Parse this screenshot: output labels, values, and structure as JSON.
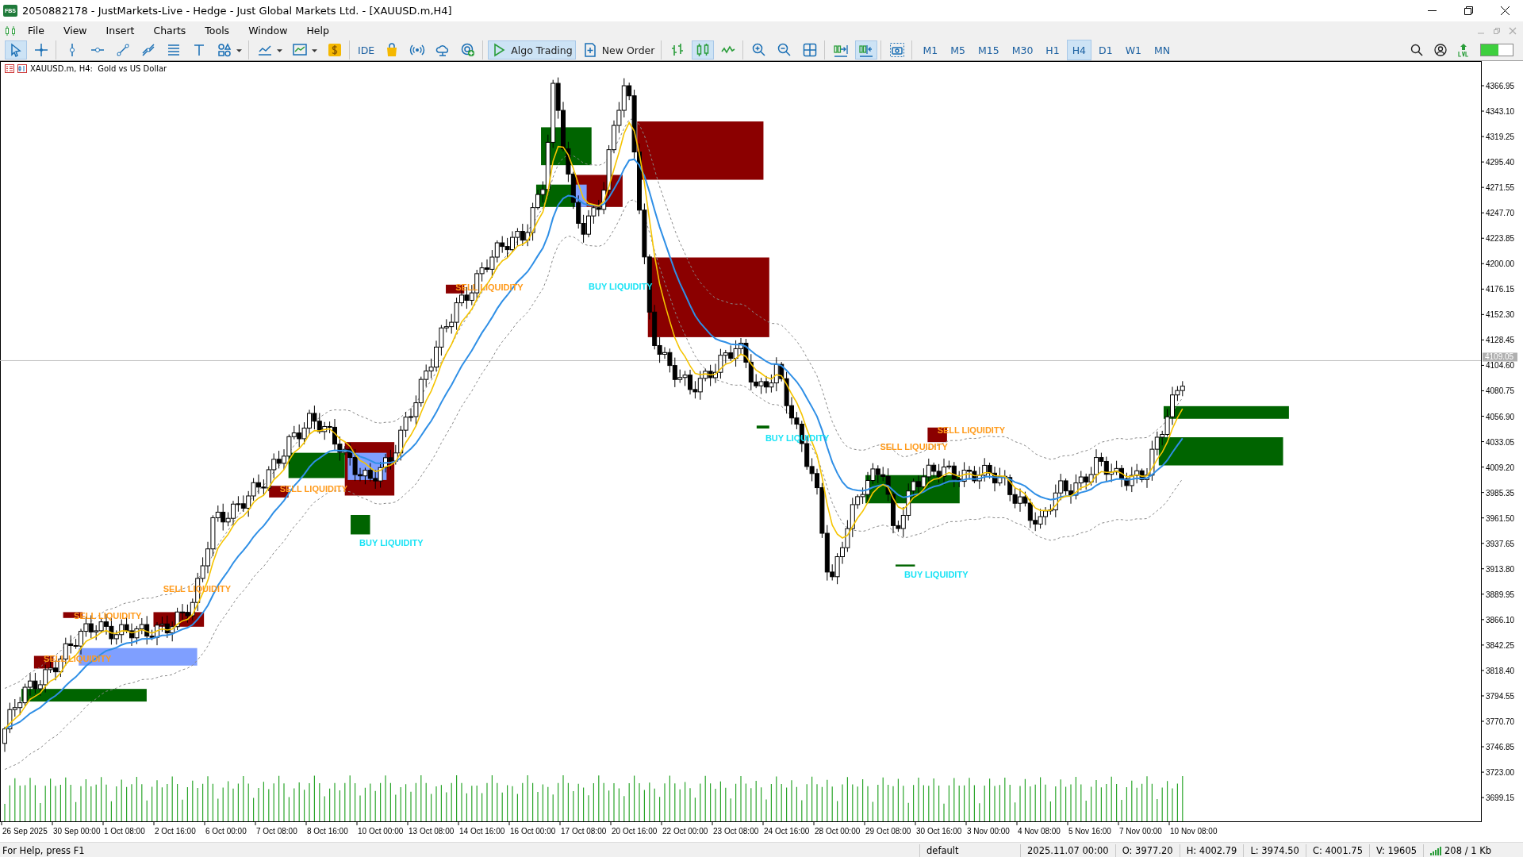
{
  "window": {
    "title": "2050882178 - JustMarkets-Live - Hedge - Just Global Markets Ltd. - [XAUUSD.m,H4]",
    "app_badge": "FBS"
  },
  "menu": [
    "File",
    "View",
    "Insert",
    "Charts",
    "Tools",
    "Window",
    "Help"
  ],
  "toolbar": [
    [
      {
        "kind": "cursor",
        "selected": true
      },
      {
        "kind": "crosshair",
        "selected": false
      }
    ],
    [
      {
        "kind": "vline",
        "selected": false
      },
      {
        "kind": "hline",
        "selected": false
      },
      {
        "kind": "trendline",
        "selected": false
      },
      {
        "kind": "channel",
        "selected": false
      },
      {
        "kind": "fibo",
        "selected": false
      },
      {
        "kind": "textTool",
        "selected": false
      },
      {
        "kind": "shapes",
        "selected": false
      }
    ],
    [
      {
        "kind": "indicators",
        "selected": false
      },
      {
        "kind": "templates",
        "selected": false
      },
      {
        "kind": "dollar",
        "selected": false
      }
    ],
    [
      {
        "kind": "label",
        "label": "IDE",
        "selected": false
      },
      {
        "kind": "bag",
        "selected": false
      },
      {
        "kind": "signals",
        "selected": false
      },
      {
        "kind": "cloud",
        "selected": false
      },
      {
        "kind": "vps",
        "selected": false
      }
    ],
    [
      {
        "kind": "algo",
        "label": "Algo Trading",
        "selected": true
      },
      {
        "kind": "order",
        "label": "New Order",
        "selected": false
      }
    ],
    [
      {
        "kind": "bars",
        "selected": false
      },
      {
        "kind": "candles",
        "selected": true
      },
      {
        "kind": "lineChart",
        "selected": false
      }
    ],
    [
      {
        "kind": "zoomIn",
        "selected": false
      },
      {
        "kind": "zoomOut",
        "selected": false
      },
      {
        "kind": "tile",
        "selected": false
      }
    ],
    [
      {
        "kind": "shift",
        "selected": false
      },
      {
        "kind": "autoscroll",
        "selected": true
      }
    ],
    [
      {
        "kind": "screenshot",
        "selected": false
      }
    ]
  ],
  "timeframes": [
    {
      "label": "M1",
      "selected": false
    },
    {
      "label": "M5",
      "selected": false
    },
    {
      "label": "M15",
      "selected": false
    },
    {
      "label": "M30",
      "selected": false
    },
    {
      "label": "H1",
      "selected": false
    },
    {
      "label": "H4",
      "selected": true
    },
    {
      "label": "D1",
      "selected": false
    },
    {
      "label": "W1",
      "selected": false
    },
    {
      "label": "MN",
      "selected": false
    }
  ],
  "chart": {
    "header": "XAUUSD.m, H4:  Gold vs US Dollar",
    "price_labels": [
      "4366.95",
      "4343.10",
      "4319.25",
      "4295.40",
      "4271.55",
      "4247.70",
      "4223.85",
      "4200.00",
      "4176.15",
      "4152.30",
      "4128.45",
      "4104.60",
      "4080.75",
      "4056.90",
      "4033.05",
      "4009.20",
      "3985.35",
      "3961.50",
      "3937.65",
      "3913.80",
      "3889.95",
      "3866.10",
      "3842.25",
      "3818.40",
      "3794.55",
      "3770.70",
      "3746.85",
      "3723.00",
      "3699.15"
    ],
    "current_price": "4109.05",
    "time_labels": [
      "26 Sep 2025",
      "30 Sep 00:00",
      "1 Oct 08:00",
      "2 Oct 16:00",
      "6 Oct 00:00",
      "7 Oct 08:00",
      "8 Oct 16:00",
      "10 Oct 00:00",
      "13 Oct 08:00",
      "14 Oct 16:00",
      "16 Oct 00:00",
      "17 Oct 08:00",
      "20 Oct 16:00",
      "22 Oct 00:00",
      "23 Oct 08:00",
      "24 Oct 16:00",
      "28 Oct 00:00",
      "29 Oct 08:00",
      "30 Oct 16:00",
      "3 Nov 00:00",
      "4 Nov 08:00",
      "5 Nov 16:00",
      "7 Nov 00:00",
      "10 Nov 08:00"
    ],
    "liquidity_labels": [
      {
        "kind": "sell",
        "text": "SELL LIQUIDITY"
      },
      {
        "kind": "sell",
        "text": "SELL LIQUIDITY"
      },
      {
        "kind": "sell",
        "text": "SELL LIQUIDITY"
      },
      {
        "kind": "sell",
        "text": "SELL LIQUIDITY"
      },
      {
        "kind": "sell",
        "text": "SELL LIQUIDITY"
      },
      {
        "kind": "sell",
        "text": "SELL LIQUIDITY"
      },
      {
        "kind": "sell",
        "text": "SELL LIQUIDITY"
      },
      {
        "kind": "buy",
        "text": "BUY LIQUIDITY"
      },
      {
        "kind": "buy",
        "text": "BUY LIQUIDITY"
      },
      {
        "kind": "buy",
        "text": "BUY LIQUIDITY"
      },
      {
        "kind": "buy",
        "text": "BUY LIQUIDITY"
      }
    ]
  },
  "status_bar": {
    "help": "For Help, press F1",
    "profile": "default",
    "datetime": "2025.11.07 00:00",
    "open": "O: 3977.20",
    "high": "H: 4002.79",
    "low": "L: 3974.50",
    "close": "C: 4001.75",
    "volume": "V: 19605",
    "traffic": "208 / 1 Kb"
  }
}
